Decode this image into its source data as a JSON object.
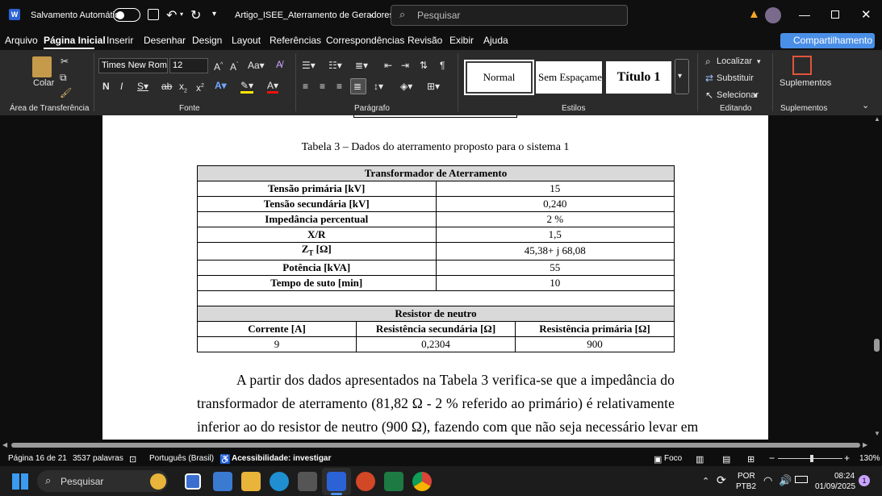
{
  "titlebar": {
    "autosave_label": "Salvamento Automático",
    "document_name": "Artigo_ISEE_Aterramento de Geradores",
    "search_placeholder": "Pesquisar"
  },
  "menu": {
    "items": [
      "Arquivo",
      "Página Inicial",
      "Inserir",
      "Desenhar",
      "Design",
      "Layout",
      "Referências",
      "Correspondências",
      "Revisão",
      "Exibir",
      "Ajuda"
    ],
    "active": "Página Inicial",
    "share_label": "Compartilhamento"
  },
  "ribbon": {
    "clipboard": {
      "paste_label": "Colar",
      "group_label": "Área de Transferência"
    },
    "font": {
      "font_name": "Times New Roma",
      "font_size": "12",
      "group_label": "Fonte"
    },
    "paragraph": {
      "group_label": "Parágrafo"
    },
    "styles": {
      "items": [
        "Normal",
        "Sem Espaçamento",
        "Título 1"
      ],
      "group_label": "Estilos"
    },
    "editing": {
      "find": "Localizar",
      "replace": "Substituir",
      "select": "Selecionar",
      "group_label": "Editando"
    },
    "addins": {
      "label": "Suplementos",
      "group_label": "Suplementos"
    }
  },
  "document": {
    "caption": "Tabela 3 – Dados do aterramento proposto para o sistema 1",
    "transformer_header": "Transformador de Aterramento",
    "transformer_rows": [
      {
        "label": "Tensão primária [kV]",
        "value": "15"
      },
      {
        "label": "Tensão secundária [kV]",
        "value": "0,240"
      },
      {
        "label": "Impedância percentual",
        "value": "2 %"
      },
      {
        "label": "X/R",
        "value": "1,5"
      },
      {
        "label": "ZT [Ω]",
        "value": "45,38+ j 68,08"
      },
      {
        "label": "Potência [kVA]",
        "value": "55"
      },
      {
        "label": "Tempo de suto [min]",
        "value": "10"
      }
    ],
    "zt": {
      "main": "Z",
      "sub": "T",
      "rest": " [Ω]"
    },
    "resistor_header": "Resistor de neutro",
    "resistor_columns": [
      "Corrente [A]",
      "Resistência secundária [Ω]",
      "Resistência primária [Ω]"
    ],
    "resistor_values": [
      "9",
      "0,2304",
      "900"
    ],
    "paragraph_lines": [
      "A partir dos dados apresentados na Tabela 3 verifica-se que a impedância do",
      "transformador de aterramento (81,82 Ω - 2 % referido ao primário) é relativamente",
      "inferior ao do resistor de neutro (900 Ω), fazendo com que não seja necessário levar em"
    ]
  },
  "statusbar": {
    "page": "Página 16 de 21",
    "words": "3537 palavras",
    "language": "Português (Brasil)",
    "accessibility": "Acessibilidade: investigar",
    "focus": "Foco",
    "zoom": "130%"
  },
  "taskbar": {
    "search_label": "Pesquisar",
    "lang_line1": "POR",
    "lang_line2": "PTB2",
    "time": "08:24",
    "date": "01/09/2025",
    "notifications": "1"
  },
  "colors": {
    "accent": "#4a8fe7",
    "ribbon_bg": "#2b2b2b",
    "window_bg": "#0f0f0f",
    "table_header_fill": "#d9d9d9"
  }
}
